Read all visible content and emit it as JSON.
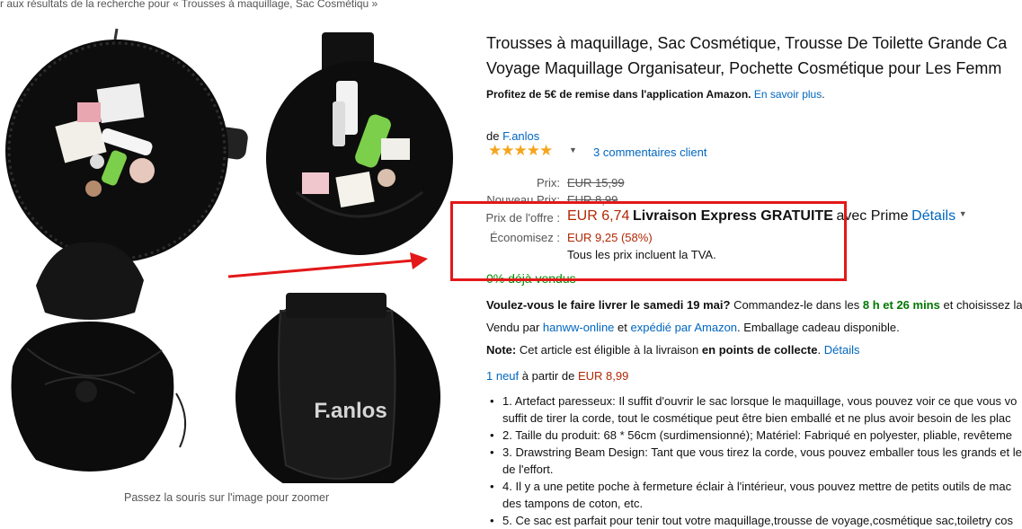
{
  "breadcrumb": "r aux résultats de la recherche pour « Trousses à maquillage, Sac Cosmétiqu »",
  "zoom_hint": "Passez la souris sur l'image pour zoomer",
  "product_images": {
    "brand_watermark": "F.anlos"
  },
  "product": {
    "title_line1": "Trousses à maquillage, Sac Cosmétique, Trousse De Toilette Grande Ca",
    "title_line2": "Voyage Maquillage Organisateur, Pochette Cosmétique pour Les Femm",
    "promo_text": "Profitez de 5€ de remise dans l'application Amazon.",
    "promo_link": "En savoir plus",
    "promo_end": ".",
    "brand_prefix": "de",
    "brand_name": "F.anlos",
    "rating": 5,
    "reviews_link": "3 commentaires client"
  },
  "price": {
    "list_label": "Prix:",
    "list_value": "EUR 15,99",
    "new_label": "Nouveau Prix:",
    "new_value": "EUR 8,99",
    "offer_label": "Prix de l'offre :",
    "offer_value": "EUR 6,74",
    "offer_shipping": "Livraison Express GRATUITE",
    "offer_prime": "avec Prime",
    "details_link": "Détails",
    "savings_label": "Économisez :",
    "savings_value": "EUR 9,25 (58%)",
    "vat_note": "Tous les prix incluent la TVA."
  },
  "deal": {
    "sold_pct": "0% déjà vendus"
  },
  "delivery": {
    "question": "Voulez-vous le faire livrer le samedi 19 mai?",
    "order_prefix": "Commandez-le dans les",
    "countdown": "8 h et 26 mins",
    "order_suffix": "et choisissez la"
  },
  "seller": {
    "prefix": "Vendu par",
    "seller_name": "hanww-online",
    "and": "et",
    "shipped_by": "expédié par Amazon",
    "gift": ". Emballage cadeau disponible."
  },
  "pickup": {
    "note_label": "Note:",
    "text": "Cet article est éligible à la livraison",
    "bold": "en points de collecte",
    "details_link": "Détails"
  },
  "offers": {
    "new_link": "1 neuf",
    "from_text": "à partir de",
    "from_price": "EUR 8,99"
  },
  "bullets": [
    "1. Artefact paresseux: Il suffit d'ouvrir le sac lorsque le maquillage, vous pouvez voir ce que vous vo",
    "suffit de tirer la corde, tout le cosmétique peut être bien emballé et ne plus avoir besoin de les plac",
    "2. Taille du produit: 68 * 56cm (surdimensionné); Matériel: Fabriqué en polyester, pliable, revêteme",
    "3. Drawstring Beam Design: Tant que vous tirez la corde, vous pouvez emballer tous les grands et le",
    "de l'effort.",
    "4. Il y a une petite poche à fermeture éclair à l'intérieur, vous pouvez mettre de petits outils de mac",
    "des tampons de coton, etc.",
    "5. Ce sac est parfait pour tenir tout votre maquillage,trousse de voyage,cosmétique sac,toiletry cos"
  ],
  "colors": {
    "link": "#0066c0",
    "price_red": "#b12704",
    "highlight_red": "#e31818",
    "star": "#f7a41d",
    "green": "#007600"
  }
}
